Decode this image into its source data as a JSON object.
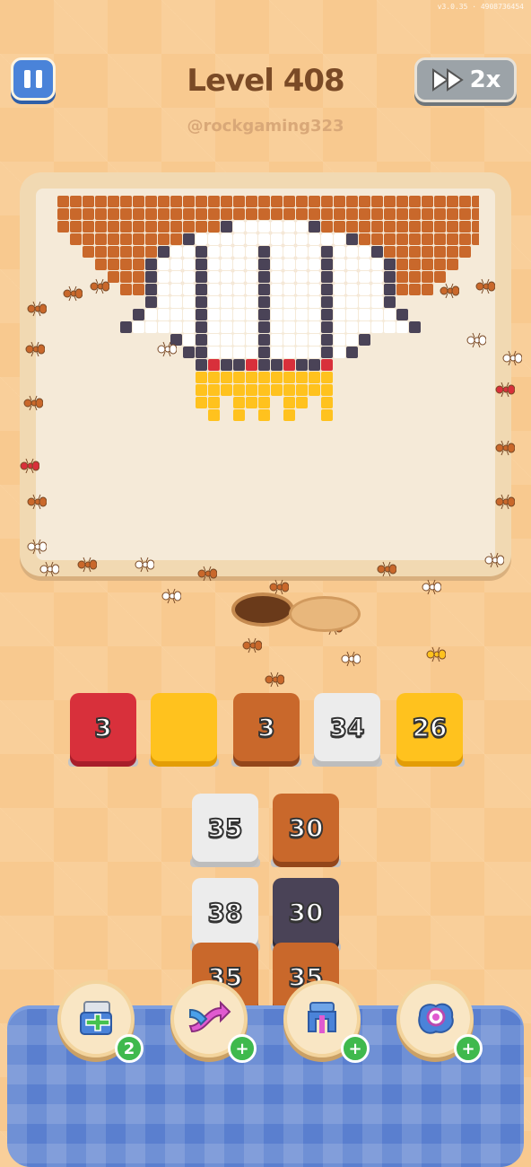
{
  "version_text": "v3.0.35 · 4908736454",
  "header": {
    "level_title": "Level 408",
    "handle": "@rockgaming323",
    "speed_label": "2x"
  },
  "colors": {
    "red": "#d8303b",
    "yellow": "#ffc21e",
    "brown": "#c9682b",
    "white": "#ececec",
    "dark": "#4a4357",
    "accent_blue": "#4a83d9"
  },
  "queue": [
    {
      "value": "3",
      "color": "red"
    },
    {
      "value": "",
      "color": "yellow"
    },
    {
      "value": "3",
      "color": "brown"
    },
    {
      "value": "34",
      "color": "white"
    },
    {
      "value": "26",
      "color": "yellow"
    }
  ],
  "stack_left": [
    {
      "value": "35",
      "color": "white"
    },
    {
      "value": "38",
      "color": "white"
    },
    {
      "value": "35",
      "color": "brown"
    }
  ],
  "stack_right": [
    {
      "value": "30",
      "color": "brown"
    },
    {
      "value": "30",
      "color": "dark"
    },
    {
      "value": "35",
      "color": "brown"
    }
  ],
  "boosters": [
    {
      "name": "add-slot-icon",
      "badge": "2"
    },
    {
      "name": "shuffle-icon",
      "badge": "+"
    },
    {
      "name": "magnet-icon",
      "badge": "+"
    },
    {
      "name": "disc-icon",
      "badge": "+"
    }
  ]
}
